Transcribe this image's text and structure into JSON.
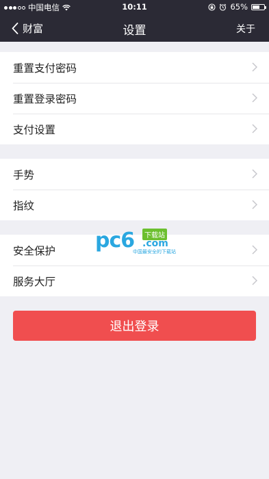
{
  "status_bar": {
    "carrier": "中国电信",
    "time": "10:11",
    "battery": "65%",
    "battery_level": 0.65,
    "signal_bars_filled": 3,
    "signal_bars_total": 5
  },
  "nav": {
    "back_label": "财富",
    "title": "设置",
    "right_label": "关于"
  },
  "groups": [
    {
      "items": [
        {
          "label": "重置支付密码"
        },
        {
          "label": "重置登录密码"
        },
        {
          "label": "支付设置"
        }
      ]
    },
    {
      "items": [
        {
          "label": "手势"
        },
        {
          "label": "指纹"
        }
      ]
    },
    {
      "items": [
        {
          "label": "安全保护"
        },
        {
          "label": "服务大厅"
        }
      ]
    }
  ],
  "logout_label": "退出登录",
  "watermark": {
    "brand": "pc6",
    "badge": "下载站",
    "domain": ".com",
    "slogan": "中国最安全的下载站"
  },
  "colors": {
    "nav_bg": "#2b2a35",
    "page_bg": "#efeff4",
    "logout_bg": "#f04e4f",
    "chevron": "#c7c7cc"
  }
}
